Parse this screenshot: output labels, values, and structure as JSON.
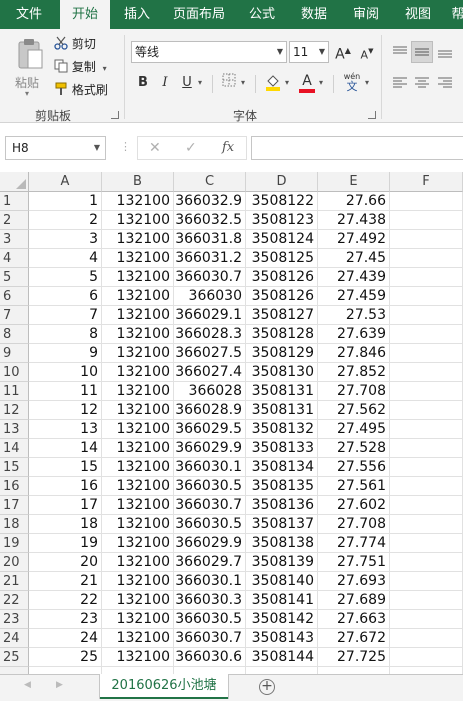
{
  "ribbon_tabs": [
    "文件",
    "开始",
    "插入",
    "页面布局",
    "公式",
    "数据",
    "审阅",
    "视图",
    "帮"
  ],
  "clipboard": {
    "paste": "粘贴",
    "cut": "剪切",
    "copy": "复制",
    "format_painter": "格式刷",
    "group_label": "剪贴板"
  },
  "font": {
    "name": "等线",
    "size": "11",
    "bold": "B",
    "italic": "I",
    "underline": "U",
    "grow": "A",
    "shrink": "A",
    "font_color_letter": "A",
    "phonetic_top": "wén",
    "phonetic_bottom": "文",
    "group_label": "字体",
    "font_color": "#e81123",
    "fill_color": "#ffd800"
  },
  "formula_bar": {
    "name_box": "H8",
    "cancel": "✕",
    "enter": "✓",
    "fx": "fx",
    "value": ""
  },
  "columns": [
    "A",
    "B",
    "C",
    "D",
    "E",
    "F"
  ],
  "rows": [
    {
      "n": "1",
      "a": "1",
      "b": "132100",
      "c": "366032.9",
      "d": "3508122",
      "e": "27.66"
    },
    {
      "n": "2",
      "a": "2",
      "b": "132100",
      "c": "366032.5",
      "d": "3508123",
      "e": "27.438"
    },
    {
      "n": "3",
      "a": "3",
      "b": "132100",
      "c": "366031.8",
      "d": "3508124",
      "e": "27.492"
    },
    {
      "n": "4",
      "a": "4",
      "b": "132100",
      "c": "366031.2",
      "d": "3508125",
      "e": "27.45"
    },
    {
      "n": "5",
      "a": "5",
      "b": "132100",
      "c": "366030.7",
      "d": "3508126",
      "e": "27.439"
    },
    {
      "n": "6",
      "a": "6",
      "b": "132100",
      "c": "366030",
      "d": "3508126",
      "e": "27.459"
    },
    {
      "n": "7",
      "a": "7",
      "b": "132100",
      "c": "366029.1",
      "d": "3508127",
      "e": "27.53"
    },
    {
      "n": "8",
      "a": "8",
      "b": "132100",
      "c": "366028.3",
      "d": "3508128",
      "e": "27.639"
    },
    {
      "n": "9",
      "a": "9",
      "b": "132100",
      "c": "366027.5",
      "d": "3508129",
      "e": "27.846"
    },
    {
      "n": "10",
      "a": "10",
      "b": "132100",
      "c": "366027.4",
      "d": "3508130",
      "e": "27.852"
    },
    {
      "n": "11",
      "a": "11",
      "b": "132100",
      "c": "366028",
      "d": "3508131",
      "e": "27.708"
    },
    {
      "n": "12",
      "a": "12",
      "b": "132100",
      "c": "366028.9",
      "d": "3508131",
      "e": "27.562"
    },
    {
      "n": "13",
      "a": "13",
      "b": "132100",
      "c": "366029.5",
      "d": "3508132",
      "e": "27.495"
    },
    {
      "n": "14",
      "a": "14",
      "b": "132100",
      "c": "366029.9",
      "d": "3508133",
      "e": "27.528"
    },
    {
      "n": "15",
      "a": "15",
      "b": "132100",
      "c": "366030.1",
      "d": "3508134",
      "e": "27.556"
    },
    {
      "n": "16",
      "a": "16",
      "b": "132100",
      "c": "366030.5",
      "d": "3508135",
      "e": "27.561"
    },
    {
      "n": "17",
      "a": "17",
      "b": "132100",
      "c": "366030.7",
      "d": "3508136",
      "e": "27.602"
    },
    {
      "n": "18",
      "a": "18",
      "b": "132100",
      "c": "366030.5",
      "d": "3508137",
      "e": "27.708"
    },
    {
      "n": "19",
      "a": "19",
      "b": "132100",
      "c": "366029.9",
      "d": "3508138",
      "e": "27.774"
    },
    {
      "n": "20",
      "a": "20",
      "b": "132100",
      "c": "366029.7",
      "d": "3508139",
      "e": "27.751"
    },
    {
      "n": "21",
      "a": "21",
      "b": "132100",
      "c": "366030.1",
      "d": "3508140",
      "e": "27.693"
    },
    {
      "n": "22",
      "a": "22",
      "b": "132100",
      "c": "366030.3",
      "d": "3508141",
      "e": "27.689"
    },
    {
      "n": "23",
      "a": "23",
      "b": "132100",
      "c": "366030.5",
      "d": "3508142",
      "e": "27.663"
    },
    {
      "n": "24",
      "a": "24",
      "b": "132100",
      "c": "366030.7",
      "d": "3508143",
      "e": "27.672"
    },
    {
      "n": "25",
      "a": "25",
      "b": "132100",
      "c": "366030.6",
      "d": "3508144",
      "e": "27.725"
    }
  ],
  "sheet_tabs": [
    "20160626小池塘"
  ],
  "colors": {
    "accent": "#217346",
    "header_bg": "#f2f2f2",
    "ribbon_bg": "#f3f3f3"
  }
}
